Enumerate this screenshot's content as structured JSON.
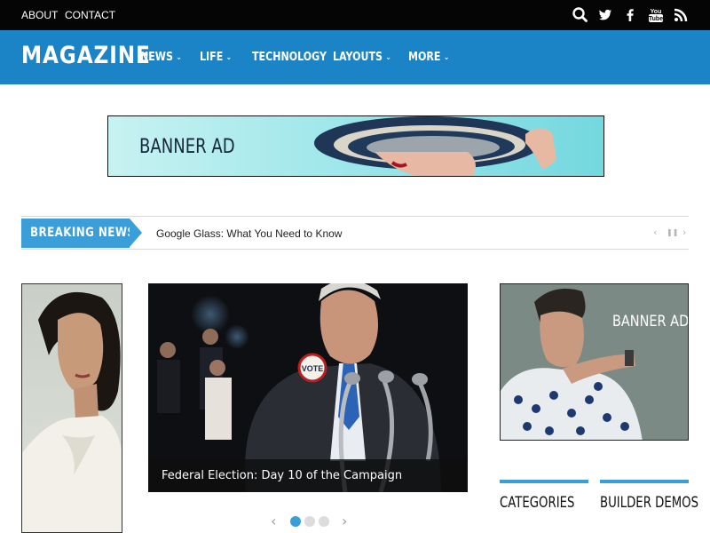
{
  "topbar": {
    "links": [
      "ABOUT",
      "CONTACT"
    ],
    "icons": [
      "search-icon",
      "twitter-icon",
      "facebook-icon",
      "youtube-icon",
      "rss-icon"
    ]
  },
  "header": {
    "logo": "MAGAZINE",
    "nav": [
      {
        "label": "NEWS",
        "dropdown": true
      },
      {
        "label": "LIFE",
        "dropdown": true
      },
      {
        "label": "TECHNOLOGY",
        "dropdown": false
      },
      {
        "label": "LAYOUTS",
        "dropdown": true
      },
      {
        "label": "MORE",
        "dropdown": true
      }
    ],
    "chevron": "⌄"
  },
  "banner_ad": {
    "text": "BANNER AD"
  },
  "breaking_news": {
    "label": "BREAKING NEWS",
    "headline": "Google Glass: What You Need to Know",
    "controls": {
      "prev": "‹",
      "pause": "❚❚",
      "next": "›"
    }
  },
  "slider": {
    "caption": "Federal Election: Day 10 of the Campaign",
    "badge": "VOTE",
    "prev": "‹",
    "next": "›",
    "dots": 3,
    "active_dot": 1
  },
  "sidebar_ad": {
    "text": "BANNER AD"
  },
  "widgets": {
    "categories": "CATEGORIES",
    "builder_demos": "BUILDER DEMOS"
  },
  "colors": {
    "nav_blue": "#1a84c6",
    "accent": "#3a9fd9",
    "topbar": "#050505"
  }
}
